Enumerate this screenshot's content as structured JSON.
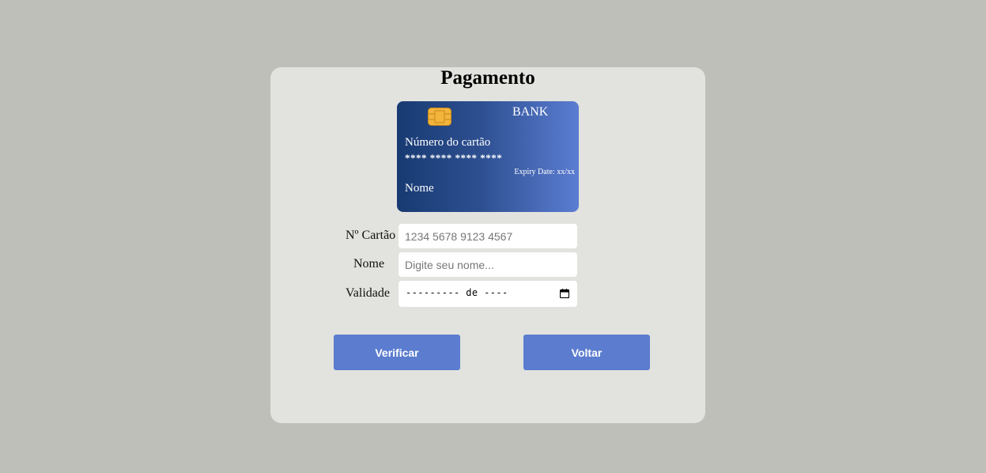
{
  "page": {
    "title": "Pagamento"
  },
  "card": {
    "bank": "BANK",
    "number_label": "Número do cartão",
    "number_masked": "**** **** **** ****",
    "expiry": "Expiry Date: xx/xx",
    "name": "Nome"
  },
  "form": {
    "card_number": {
      "label": "Nº Cartão",
      "placeholder": "1234 5678 9123 4567",
      "value": ""
    },
    "name": {
      "label": "Nome",
      "placeholder": "Digite seu nome...",
      "value": ""
    },
    "expiry": {
      "label": "Validade",
      "display": "--------- de ----"
    }
  },
  "buttons": {
    "verify": "Verificar",
    "back": "Voltar"
  },
  "colors": {
    "background": "#bfbfba",
    "panel": "#e2e2de",
    "button": "#5b7ccf",
    "card_gradient_start": "#183a72",
    "card_gradient_end": "#5b7dd2",
    "chip": "#f2b43a"
  },
  "icons": {
    "chip": "card-chip-icon",
    "calendar": "calendar-icon"
  }
}
